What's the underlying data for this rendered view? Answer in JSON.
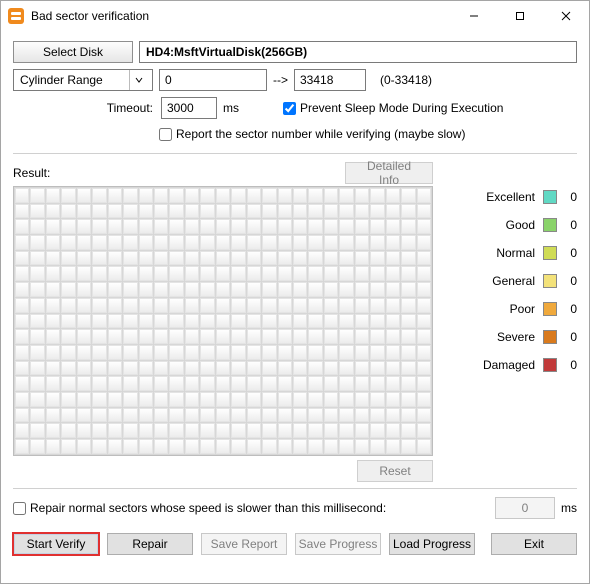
{
  "window": {
    "title": "Bad sector verification"
  },
  "toolbar": {
    "select_disk": "Select Disk",
    "disk_name": "HD4:MsftVirtualDisk(256GB)",
    "range_mode": "Cylinder Range",
    "range_from": "0",
    "range_arrow": "-->",
    "range_to": "33418",
    "range_hint": "(0-33418)",
    "timeout_label": "Timeout:",
    "timeout_value": "3000",
    "timeout_unit": "ms",
    "prevent_sleep_label": "Prevent Sleep Mode During Execution",
    "prevent_sleep_checked": true,
    "report_sector_label": "Report the sector number while verifying (maybe slow)",
    "report_sector_checked": false
  },
  "result": {
    "label": "Result:",
    "detailed_info": "Detailed Info",
    "reset": "Reset",
    "legend": [
      {
        "key": "excellent",
        "label": "Excellent",
        "count": 0
      },
      {
        "key": "good",
        "label": "Good",
        "count": 0
      },
      {
        "key": "normal",
        "label": "Normal",
        "count": 0
      },
      {
        "key": "general",
        "label": "General",
        "count": 0
      },
      {
        "key": "poor",
        "label": "Poor",
        "count": 0
      },
      {
        "key": "severe",
        "label": "Severe",
        "count": 0
      },
      {
        "key": "damaged",
        "label": "Damaged",
        "count": 0
      }
    ]
  },
  "repair": {
    "checkbox_label": "Repair normal sectors whose speed is slower than this millisecond:",
    "checkbox_checked": false,
    "threshold_value": "0",
    "threshold_unit": "ms"
  },
  "buttons": {
    "start_verify": "Start Verify",
    "repair": "Repair",
    "save_report": "Save Report",
    "save_progress": "Save Progress",
    "load_progress": "Load Progress",
    "exit": "Exit"
  }
}
